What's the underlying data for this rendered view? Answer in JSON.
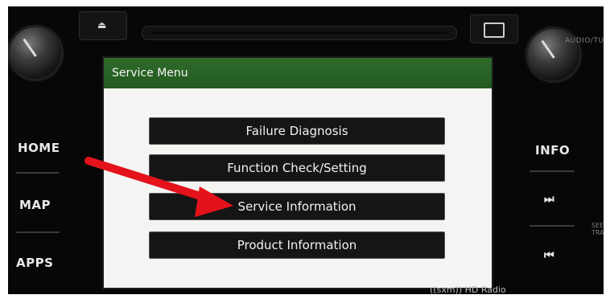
{
  "screen": {
    "title": "Service Menu",
    "menu_items": [
      {
        "label": "Failure Diagnosis"
      },
      {
        "label": "Function Check/Setting"
      },
      {
        "label": "Service Information"
      },
      {
        "label": "Product Information"
      }
    ]
  },
  "bezel": {
    "left_buttons": {
      "home": "HOME",
      "map": "MAP",
      "apps": "APPS"
    },
    "right_buttons": {
      "info": "INFO",
      "next_glyph": "⏭",
      "prev_glyph": "⏮"
    },
    "audio_label": "AUDIO/TUN",
    "seek_label": "SEEK\nTRAC",
    "brand": "((sxm)) HD Radio",
    "eject_glyph": "⏏"
  },
  "colors": {
    "titlebar_green": "#2f6a2a",
    "menu_button": "#151515",
    "screen_bg": "#f4f4f2",
    "arrow_red": "#e3121b"
  },
  "icons": [
    "eject-icon",
    "sd-card-icon",
    "next-track-icon",
    "previous-track-icon",
    "red-arrow-icon"
  ]
}
